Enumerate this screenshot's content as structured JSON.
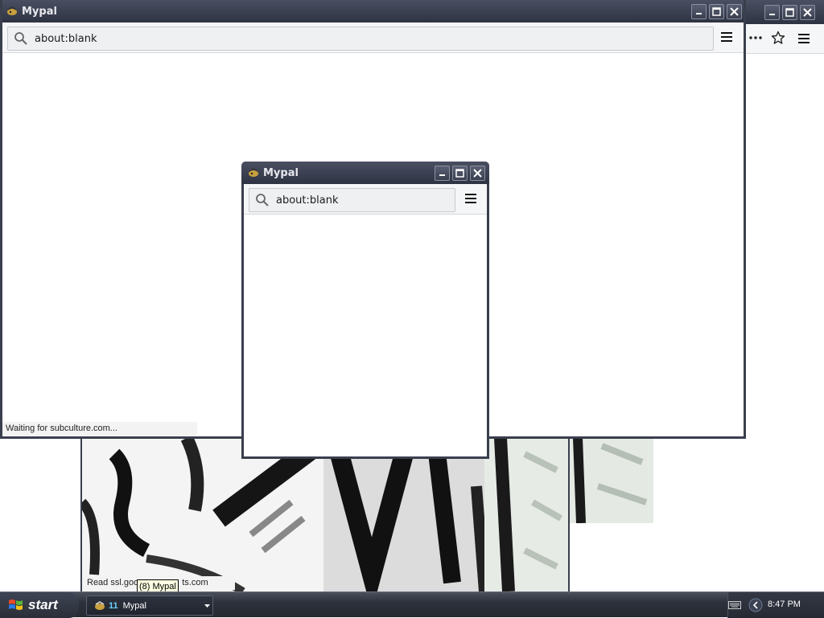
{
  "app": {
    "title": "Mypal"
  },
  "bg_window": {
    "title": "Mypal",
    "url": "about:blank",
    "status": "Waiting for subculture.com..."
  },
  "front_window": {
    "title": "Mypal",
    "url": "about:blank"
  },
  "image_window": {
    "status": "Read ssl.goo",
    "status_suffix": "ts.com"
  },
  "tooltip": {
    "text": "(8) Mypal"
  },
  "taskbar": {
    "start_label": "start",
    "task_count": "11",
    "task_label": "Mypal",
    "clock": "8:47 PM"
  },
  "colors": {
    "titlebar": "#2e3342",
    "accent": "#4a5062"
  }
}
